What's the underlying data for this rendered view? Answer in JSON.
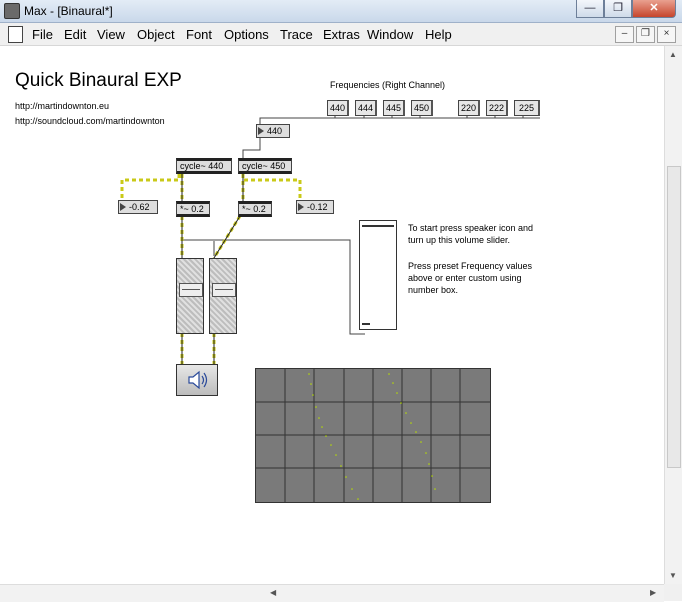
{
  "window": {
    "title": "Max - [Binaural*]",
    "buttons": [
      "—",
      "❐",
      "✕"
    ]
  },
  "menu": {
    "items": [
      "File",
      "Edit",
      "View",
      "Object",
      "Font",
      "Options",
      "Trace",
      "Extras",
      "Window",
      "Help"
    ],
    "mdi_buttons": [
      "–",
      "❐",
      "×"
    ]
  },
  "patch": {
    "title": "Quick Binaural EXP",
    "links": [
      "http://martindownton.eu",
      "http://soundcloud.com/martindownton"
    ],
    "freq_label": "Frequencies (Right Channel)",
    "presets": [
      "440",
      "444",
      "445",
      "450",
      "220",
      "222",
      "225"
    ],
    "number_right": "440",
    "cycle_left": "cycle~ 440",
    "cycle_right": "cycle~ 450",
    "num_left": "-0.62",
    "num_right": "-0.12",
    "mult_left": "*~ 0.2",
    "mult_right": "*~ 0.2",
    "instructions": [
      "To start press speaker icon and turn up this volume slider.",
      "Press preset Frequency values above or enter custom using number box."
    ]
  },
  "colors": {
    "patch_cord": "#c9c918",
    "scope_bg": "#7a7a7a",
    "scope_trace": "#b8e000"
  }
}
